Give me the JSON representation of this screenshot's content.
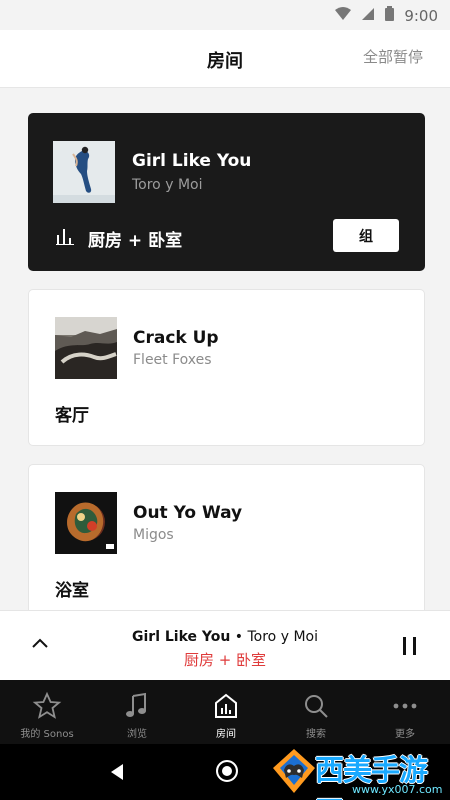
{
  "status": {
    "time": "9:00",
    "icons": [
      "wifi-icon",
      "cellular-signal-icon",
      "battery-icon"
    ]
  },
  "header": {
    "title": "房间",
    "pause_all": "全部暂停"
  },
  "rooms": [
    {
      "track_title": "Girl Like You",
      "artist": "Toro y Moi",
      "room_name": "厨房 + 卧室",
      "group_button": "组",
      "active": true
    },
    {
      "track_title": "Crack Up",
      "artist": "Fleet Foxes",
      "room_name": "客厅"
    },
    {
      "track_title": "Out Yo Way",
      "artist": "Migos",
      "room_name": "浴室"
    }
  ],
  "now_playing": {
    "title": "Girl Like You",
    "separator": " • ",
    "artist": "Toro y Moi",
    "room": "厨房 + 卧室"
  },
  "tabs": [
    {
      "label": "我的 Sonos",
      "icon": "star-icon"
    },
    {
      "label": "浏览",
      "icon": "music-note-icon"
    },
    {
      "label": "房间",
      "icon": "home-icon",
      "active": true
    },
    {
      "label": "搜索",
      "icon": "search-icon"
    },
    {
      "label": "更多",
      "icon": "more-icon"
    }
  ],
  "watermark": {
    "text": "西美手游网",
    "url": "www.yx007.com"
  },
  "colors": {
    "accent_red": "#df3b3b",
    "dark_card": "#1a1a1a",
    "tab_bar": "#111111",
    "watermark_blue": "#19a9ff",
    "watermark_orange": "#ff9a1f"
  }
}
